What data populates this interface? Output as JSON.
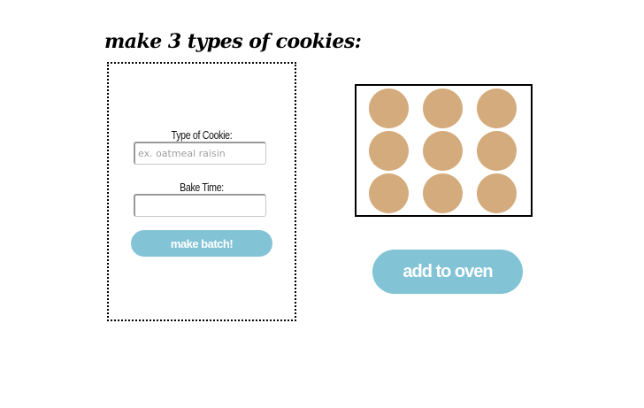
{
  "page": {
    "title": "make 3 types of cookies:"
  },
  "form": {
    "type_label": "Type of Cookie:",
    "type_placeholder": "ex. oatmeal raisin",
    "type_value": "",
    "time_label": "Bake Time:",
    "time_placeholder": "",
    "time_value": "",
    "submit_label": "make batch!"
  },
  "tray": {
    "rows": 3,
    "columns": 3,
    "cookie_color": "#d4ab7c"
  },
  "oven": {
    "button_label": "add to oven"
  },
  "colors": {
    "button": "#82c3d6",
    "button_text": "#ffffff",
    "cookie": "#d4ab7c"
  }
}
